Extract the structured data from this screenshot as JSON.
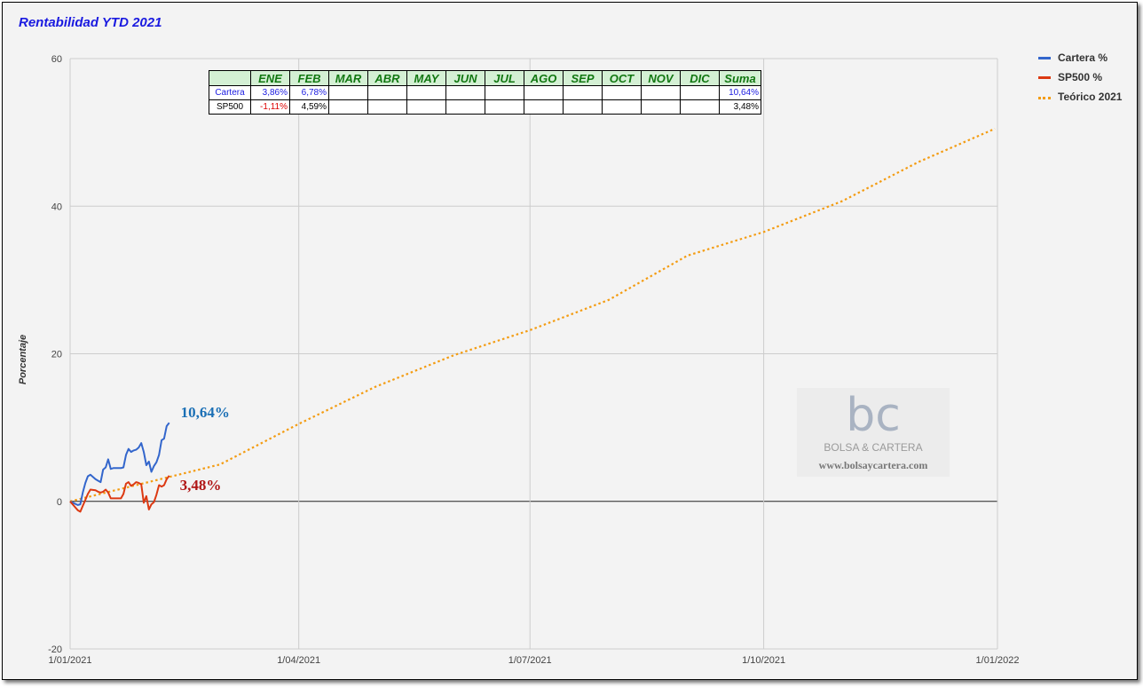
{
  "chart_data": {
    "type": "line",
    "title": "Rentabilidad YTD 2021",
    "ylabel": "Porcentaje",
    "xlabel": "",
    "ylim": [
      -20,
      60
    ],
    "yticks": [
      -20,
      0,
      20,
      40,
      60
    ],
    "xlim": [
      "2021-01-01",
      "2022-01-01"
    ],
    "xticks": [
      "1/01/2021",
      "1/04/2021",
      "1/07/2021",
      "1/10/2021",
      "1/01/2022"
    ],
    "xtick_dates": [
      "2021-01-01",
      "2021-04-01",
      "2021-07-01",
      "2021-10-01",
      "2022-01-01"
    ],
    "grid": true,
    "legend_position": "right",
    "series": [
      {
        "name": "Cartera %",
        "color": "#3366cc",
        "style": "solid",
        "points": [
          [
            "2021-01-01",
            0
          ],
          [
            "2021-01-04",
            -0.5
          ],
          [
            "2021-01-05",
            -0.4
          ],
          [
            "2021-01-06",
            1.2
          ],
          [
            "2021-01-07",
            2.5
          ],
          [
            "2021-01-08",
            3.4
          ],
          [
            "2021-01-09",
            3.6
          ],
          [
            "2021-01-11",
            3.0
          ],
          [
            "2021-01-12",
            2.8
          ],
          [
            "2021-01-13",
            2.6
          ],
          [
            "2021-01-14",
            4.3
          ],
          [
            "2021-01-15",
            4.6
          ],
          [
            "2021-01-16",
            5.7
          ],
          [
            "2021-01-17",
            4.4
          ],
          [
            "2021-01-18",
            4.5
          ],
          [
            "2021-01-19",
            4.5
          ],
          [
            "2021-01-21",
            4.5
          ],
          [
            "2021-01-22",
            4.6
          ],
          [
            "2021-01-23",
            6.3
          ],
          [
            "2021-01-24",
            7.1
          ],
          [
            "2021-01-25",
            6.7
          ],
          [
            "2021-01-26",
            6.9
          ],
          [
            "2021-01-27",
            7.0
          ],
          [
            "2021-01-28",
            7.3
          ],
          [
            "2021-01-29",
            7.9
          ],
          [
            "2021-01-30",
            6.7
          ],
          [
            "2021-01-31",
            4.9
          ],
          [
            "2021-02-01",
            5.4
          ],
          [
            "2021-02-02",
            4.0
          ],
          [
            "2021-02-03",
            4.8
          ],
          [
            "2021-02-04",
            5.3
          ],
          [
            "2021-02-05",
            6.3
          ],
          [
            "2021-02-06",
            8.3
          ],
          [
            "2021-02-07",
            8.5
          ],
          [
            "2021-02-08",
            10.2
          ],
          [
            "2021-02-09",
            10.64
          ]
        ]
      },
      {
        "name": "SP500 %",
        "color": "#dc3912",
        "style": "solid",
        "points": [
          [
            "2021-01-01",
            0
          ],
          [
            "2021-01-03",
            -0.8
          ],
          [
            "2021-01-04",
            -1.2
          ],
          [
            "2021-01-05",
            -1.4
          ],
          [
            "2021-01-06",
            -0.6
          ],
          [
            "2021-01-07",
            0.2
          ],
          [
            "2021-01-08",
            1.0
          ],
          [
            "2021-01-09",
            1.6
          ],
          [
            "2021-01-11",
            1.5
          ],
          [
            "2021-01-12",
            1.3
          ],
          [
            "2021-01-13",
            1.2
          ],
          [
            "2021-01-14",
            1.3
          ],
          [
            "2021-01-15",
            1.6
          ],
          [
            "2021-01-16",
            1.2
          ],
          [
            "2021-01-17",
            0.4
          ],
          [
            "2021-01-18",
            0.4
          ],
          [
            "2021-01-21",
            0.4
          ],
          [
            "2021-01-22",
            1.0
          ],
          [
            "2021-01-23",
            2.4
          ],
          [
            "2021-01-24",
            2.6
          ],
          [
            "2021-01-25",
            2.1
          ],
          [
            "2021-01-26",
            2.3
          ],
          [
            "2021-01-27",
            2.6
          ],
          [
            "2021-01-28",
            2.5
          ],
          [
            "2021-01-29",
            2.3
          ],
          [
            "2021-01-30",
            -0.2
          ],
          [
            "2021-01-31",
            0.7
          ],
          [
            "2021-02-01",
            -1.1
          ],
          [
            "2021-02-02",
            -0.4
          ],
          [
            "2021-02-03",
            -0.1
          ],
          [
            "2021-02-04",
            0.9
          ],
          [
            "2021-02-05",
            2.2
          ],
          [
            "2021-02-06",
            2.0
          ],
          [
            "2021-02-07",
            2.2
          ],
          [
            "2021-02-08",
            3.0
          ],
          [
            "2021-02-09",
            3.48
          ]
        ]
      },
      {
        "name": "Teórico 2021",
        "color": "#f39c12",
        "style": "dotted",
        "points": [
          [
            "2021-01-01",
            0
          ],
          [
            "2021-03-01",
            5.0
          ],
          [
            "2021-04-01",
            10.5
          ],
          [
            "2021-05-01",
            15.5
          ],
          [
            "2021-06-01",
            19.8
          ],
          [
            "2021-07-01",
            23.2
          ],
          [
            "2021-08-01",
            27.3
          ],
          [
            "2021-09-01",
            33.3
          ],
          [
            "2021-10-01",
            36.5
          ],
          [
            "2021-11-01",
            40.7
          ],
          [
            "2021-12-01",
            46.0
          ],
          [
            "2021-12-31",
            50.5
          ]
        ]
      }
    ],
    "end_labels": [
      {
        "text": "10,64%",
        "color": "#1a6fb5",
        "value": 10.64
      },
      {
        "text": "3,48%",
        "color": "#b01515",
        "value": 3.48
      }
    ],
    "table": {
      "columns": [
        "",
        "ENE",
        "FEB",
        "MAR",
        "ABR",
        "MAY",
        "JUN",
        "JUL",
        "AGO",
        "SEP",
        "OCT",
        "NOV",
        "DIC",
        "Suma"
      ],
      "rows": [
        {
          "label": "Cartera",
          "cells": [
            "3,86%",
            "6,78%",
            "",
            "",
            "",
            "",
            "",
            "",
            "",
            "",
            "",
            ""
          ],
          "sum": "10,64%",
          "label_color": "#1a1ae0",
          "cell_colors": [
            "#1a1ae0",
            "#1a1ae0"
          ],
          "sum_color": "#1a1ae0"
        },
        {
          "label": "SP500",
          "cells": [
            "-1,11%",
            "4,59%",
            "",
            "",
            "",
            "",
            "",
            "",
            "",
            "",
            "",
            ""
          ],
          "sum": "3,48%",
          "label_color": "#000000",
          "cell_colors": [
            "#dd0000",
            "#000000"
          ],
          "sum_color": "#000000"
        }
      ]
    }
  },
  "watermark": {
    "logo_text": "bc",
    "name": "BOLSA & CARTERA",
    "url": "www.bolsaycartera.com"
  }
}
